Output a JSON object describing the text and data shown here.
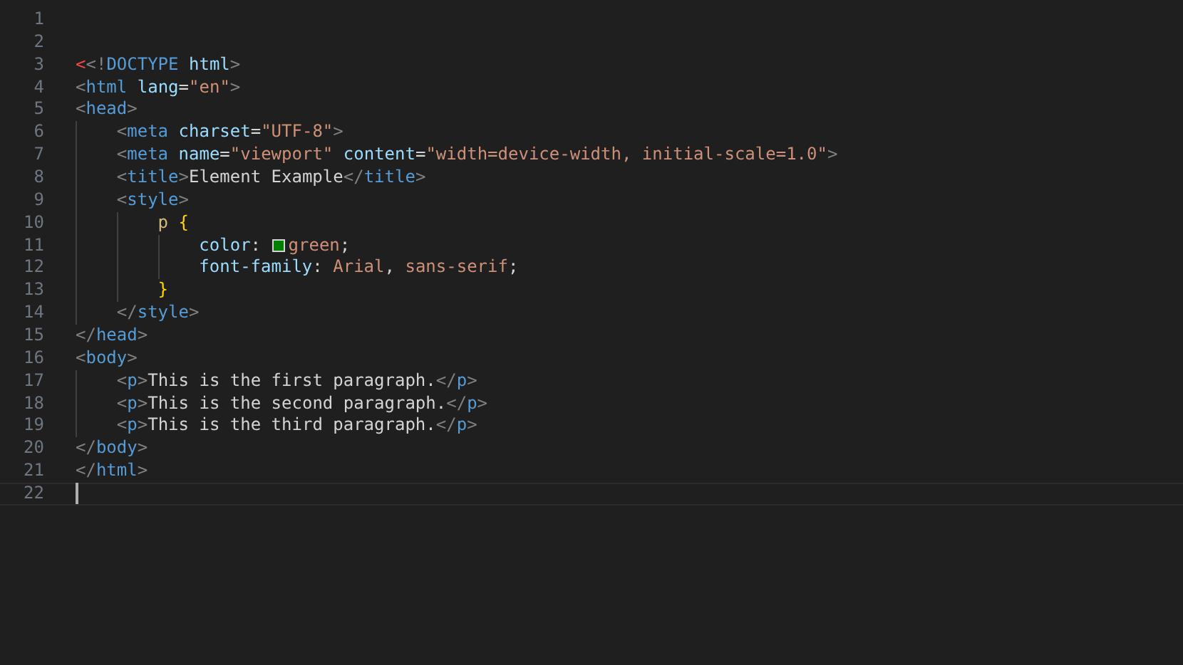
{
  "editor": {
    "lines": [
      {
        "number": "1",
        "current": false
      },
      {
        "number": "2",
        "current": false
      },
      {
        "number": "3",
        "current": false,
        "tokens": [
          {
            "kind": "invalid",
            "text": "<"
          },
          {
            "kind": "bracket",
            "text": "<!"
          },
          {
            "kind": "tag",
            "text": "DOCTYPE"
          },
          {
            "kind": "space"
          },
          {
            "kind": "attr",
            "text": "html"
          },
          {
            "kind": "bracket",
            "text": ">"
          }
        ]
      },
      {
        "number": "4",
        "current": false,
        "tokens": [
          {
            "kind": "bracket",
            "text": "<"
          },
          {
            "kind": "tag",
            "text": "html"
          },
          {
            "kind": "space"
          },
          {
            "kind": "attr",
            "text": "lang"
          },
          {
            "kind": "text",
            "text": "="
          },
          {
            "kind": "string",
            "text": "\"en\""
          },
          {
            "kind": "bracket",
            "text": ">"
          }
        ]
      },
      {
        "number": "5",
        "current": false,
        "tokens": [
          {
            "kind": "bracket",
            "text": "<"
          },
          {
            "kind": "tag",
            "text": "head"
          },
          {
            "kind": "bracket",
            "text": ">"
          }
        ]
      },
      {
        "number": "6",
        "current": false,
        "tokens": [
          {
            "kind": "indent"
          },
          {
            "kind": "bracket",
            "text": "<"
          },
          {
            "kind": "tag",
            "text": "meta"
          },
          {
            "kind": "space"
          },
          {
            "kind": "attr",
            "text": "charset"
          },
          {
            "kind": "text",
            "text": "="
          },
          {
            "kind": "string",
            "text": "\"UTF-8\""
          },
          {
            "kind": "bracket",
            "text": ">"
          }
        ]
      },
      {
        "number": "7",
        "current": false,
        "tokens": [
          {
            "kind": "indent"
          },
          {
            "kind": "bracket",
            "text": "<"
          },
          {
            "kind": "tag",
            "text": "meta"
          },
          {
            "kind": "space"
          },
          {
            "kind": "attr",
            "text": "name"
          },
          {
            "kind": "text",
            "text": "="
          },
          {
            "kind": "string",
            "text": "\"viewport\""
          },
          {
            "kind": "space"
          },
          {
            "kind": "attr",
            "text": "content"
          },
          {
            "kind": "text",
            "text": "="
          },
          {
            "kind": "string",
            "text": "\"width=device-width, initial-scale=1.0\""
          },
          {
            "kind": "bracket",
            "text": ">"
          }
        ]
      },
      {
        "number": "8",
        "current": false,
        "tokens": [
          {
            "kind": "indent"
          },
          {
            "kind": "bracket",
            "text": "<"
          },
          {
            "kind": "tag",
            "text": "title"
          },
          {
            "kind": "bracket",
            "text": ">"
          },
          {
            "kind": "text",
            "text": "Element Example"
          },
          {
            "kind": "bracket",
            "text": "</"
          },
          {
            "kind": "tag",
            "text": "title"
          },
          {
            "kind": "bracket",
            "text": ">"
          }
        ]
      },
      {
        "number": "9",
        "current": false,
        "tokens": [
          {
            "kind": "indent"
          },
          {
            "kind": "bracket",
            "text": "<"
          },
          {
            "kind": "tag",
            "text": "style"
          },
          {
            "kind": "bracket",
            "text": ">"
          }
        ]
      },
      {
        "number": "10",
        "current": false,
        "tokens": [
          {
            "kind": "indent"
          },
          {
            "kind": "indent"
          },
          {
            "kind": "selector",
            "text": "p"
          },
          {
            "kind": "space"
          },
          {
            "kind": "brace",
            "text": "{"
          }
        ]
      },
      {
        "number": "11",
        "current": false,
        "tokens": [
          {
            "kind": "indent"
          },
          {
            "kind": "indent"
          },
          {
            "kind": "indent"
          },
          {
            "kind": "prop",
            "text": "color"
          },
          {
            "kind": "text",
            "text": ":"
          },
          {
            "kind": "space"
          },
          {
            "kind": "swatch",
            "color": "#008000"
          },
          {
            "kind": "value",
            "text": "green"
          },
          {
            "kind": "text",
            "text": ";"
          }
        ]
      },
      {
        "number": "12",
        "current": false,
        "tokens": [
          {
            "kind": "indent"
          },
          {
            "kind": "indent"
          },
          {
            "kind": "indent"
          },
          {
            "kind": "prop",
            "text": "font-family"
          },
          {
            "kind": "text",
            "text": ":"
          },
          {
            "kind": "space"
          },
          {
            "kind": "value",
            "text": "Arial"
          },
          {
            "kind": "text",
            "text": ","
          },
          {
            "kind": "space"
          },
          {
            "kind": "value",
            "text": "sans-serif"
          },
          {
            "kind": "text",
            "text": ";"
          }
        ]
      },
      {
        "number": "13",
        "current": false,
        "tokens": [
          {
            "kind": "indent"
          },
          {
            "kind": "indent"
          },
          {
            "kind": "brace",
            "text": "}"
          }
        ]
      },
      {
        "number": "14",
        "current": false,
        "tokens": [
          {
            "kind": "indent"
          },
          {
            "kind": "bracket",
            "text": "</"
          },
          {
            "kind": "tag",
            "text": "style"
          },
          {
            "kind": "bracket",
            "text": ">"
          }
        ]
      },
      {
        "number": "15",
        "current": false,
        "tokens": [
          {
            "kind": "bracket",
            "text": "</"
          },
          {
            "kind": "tag",
            "text": "head"
          },
          {
            "kind": "bracket",
            "text": ">"
          }
        ]
      },
      {
        "number": "16",
        "current": false,
        "tokens": [
          {
            "kind": "bracket",
            "text": "<"
          },
          {
            "kind": "tag",
            "text": "body"
          },
          {
            "kind": "bracket",
            "text": ">"
          }
        ]
      },
      {
        "number": "17",
        "current": false,
        "tokens": [
          {
            "kind": "indent"
          },
          {
            "kind": "bracket",
            "text": "<"
          },
          {
            "kind": "tag",
            "text": "p"
          },
          {
            "kind": "bracket",
            "text": ">"
          },
          {
            "kind": "text",
            "text": "This is the first paragraph."
          },
          {
            "kind": "bracket",
            "text": "</"
          },
          {
            "kind": "tag",
            "text": "p"
          },
          {
            "kind": "bracket",
            "text": ">"
          }
        ]
      },
      {
        "number": "18",
        "current": false,
        "tokens": [
          {
            "kind": "indent"
          },
          {
            "kind": "bracket",
            "text": "<"
          },
          {
            "kind": "tag",
            "text": "p"
          },
          {
            "kind": "bracket",
            "text": ">"
          },
          {
            "kind": "text",
            "text": "This is the second paragraph."
          },
          {
            "kind": "bracket",
            "text": "</"
          },
          {
            "kind": "tag",
            "text": "p"
          },
          {
            "kind": "bracket",
            "text": ">"
          }
        ]
      },
      {
        "number": "19",
        "current": false,
        "tokens": [
          {
            "kind": "indent"
          },
          {
            "kind": "bracket",
            "text": "<"
          },
          {
            "kind": "tag",
            "text": "p"
          },
          {
            "kind": "bracket",
            "text": ">"
          },
          {
            "kind": "text",
            "text": "This is the third paragraph."
          },
          {
            "kind": "bracket",
            "text": "</"
          },
          {
            "kind": "tag",
            "text": "p"
          },
          {
            "kind": "bracket",
            "text": ">"
          }
        ]
      },
      {
        "number": "20",
        "current": false,
        "tokens": [
          {
            "kind": "bracket",
            "text": "</"
          },
          {
            "kind": "tag",
            "text": "body"
          },
          {
            "kind": "bracket",
            "text": ">"
          }
        ]
      },
      {
        "number": "21",
        "current": false,
        "tokens": [
          {
            "kind": "bracket",
            "text": "</"
          },
          {
            "kind": "tag",
            "text": "html"
          },
          {
            "kind": "bracket",
            "text": ">"
          }
        ]
      },
      {
        "number": "22",
        "current": true
      }
    ]
  }
}
